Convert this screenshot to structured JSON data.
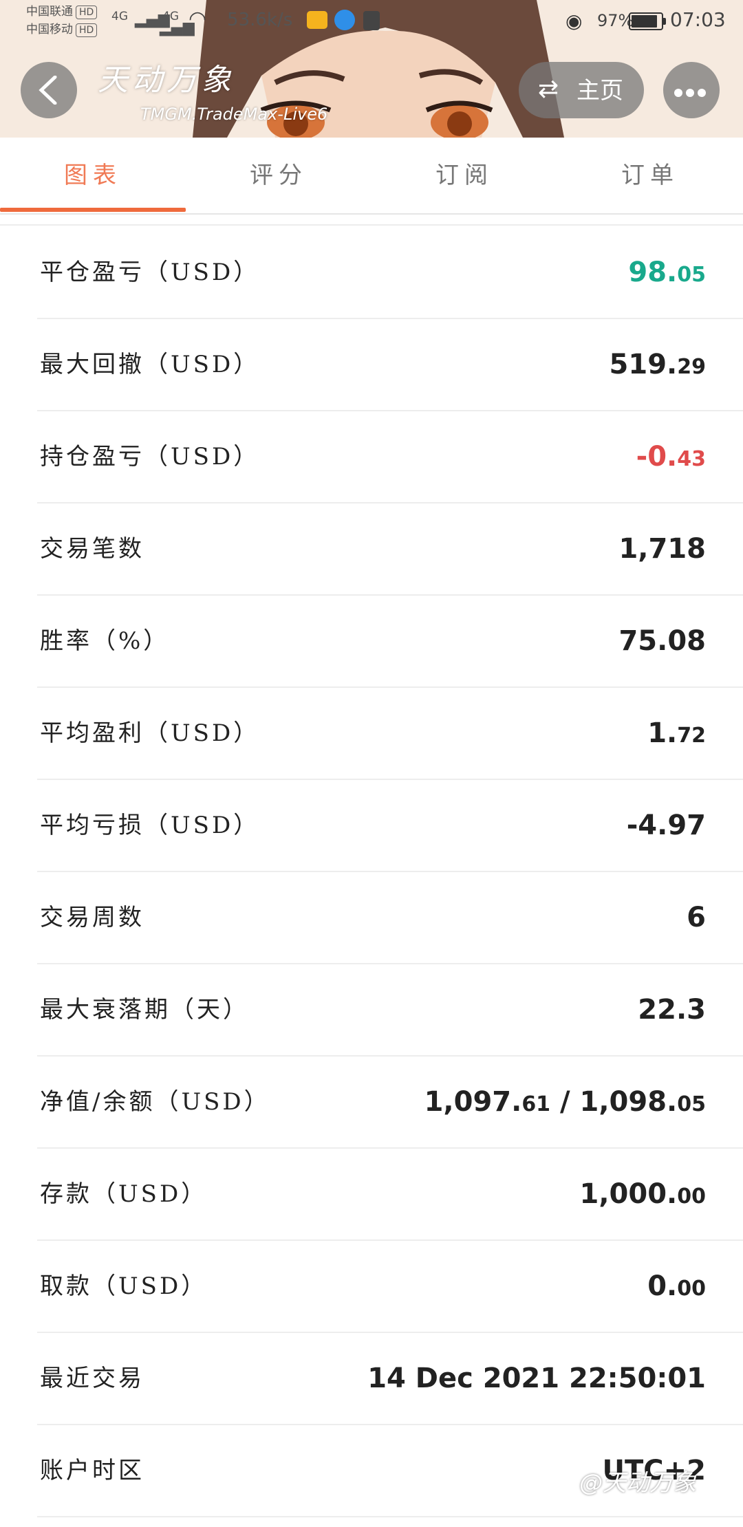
{
  "status_bar": {
    "carrier1": "中国联通",
    "carrier2": "中国移动",
    "hd": "HD",
    "net1": "4G",
    "net2": "4G",
    "speed": "53.6k/s",
    "battery_pct": "97%",
    "battery_level": 0.97,
    "time": "07:03"
  },
  "header": {
    "title": "天动万象",
    "subtitle": "TMGM.TradeMax-Live6",
    "home_label": "主页"
  },
  "tabs": [
    {
      "label": "图表",
      "active": true
    },
    {
      "label": "评分",
      "active": false
    },
    {
      "label": "订阅",
      "active": false
    },
    {
      "label": "订单",
      "active": false
    }
  ],
  "stats": [
    {
      "label": "平仓盈亏（USD）",
      "int": "98.",
      "dec": "05",
      "tone": "pos"
    },
    {
      "label": "最大回撤（USD）",
      "int": "519.",
      "dec": "29",
      "tone": ""
    },
    {
      "label": "持仓盈亏（USD）",
      "int": "-0.",
      "dec": "43",
      "tone": "neg"
    },
    {
      "label": "交易笔数",
      "int": "1,718",
      "dec": "",
      "tone": ""
    },
    {
      "label": "胜率（%）",
      "int": "75.08",
      "dec": "",
      "tone": ""
    },
    {
      "label": "平均盈利（USD）",
      "int": "1.",
      "dec": "72",
      "tone": ""
    },
    {
      "label": "平均亏损（USD）",
      "int": "-4.97",
      "dec": "",
      "tone": ""
    },
    {
      "label": "交易周数",
      "int": "6",
      "dec": "",
      "tone": ""
    },
    {
      "label": "最大衰落期（天）",
      "int": "22.3",
      "dec": "",
      "tone": ""
    },
    {
      "label": "净值/余额（USD）",
      "int": "1,097.",
      "dec": "61",
      "int2": " / 1,098.",
      "dec2": "05",
      "tone": ""
    },
    {
      "label": "存款（USD）",
      "int": "1,000.",
      "dec": "00",
      "tone": ""
    },
    {
      "label": "取款（USD）",
      "int": "0.",
      "dec": "00",
      "tone": ""
    },
    {
      "label": "最近交易",
      "int": "14 Dec 2021 22:50:01",
      "dec": "",
      "tone": ""
    },
    {
      "label": "账户时区",
      "int": "UTC+2",
      "dec": "",
      "tone": ""
    }
  ],
  "watermark": "@天动万象",
  "colors": {
    "accent": "#ef6a3c",
    "positive": "#19a98c",
    "negative": "#e04b4b"
  },
  "icons": {
    "back": "chevron-left-icon",
    "switch": "swap-arrows-icon",
    "more": "more-dots-icon"
  }
}
